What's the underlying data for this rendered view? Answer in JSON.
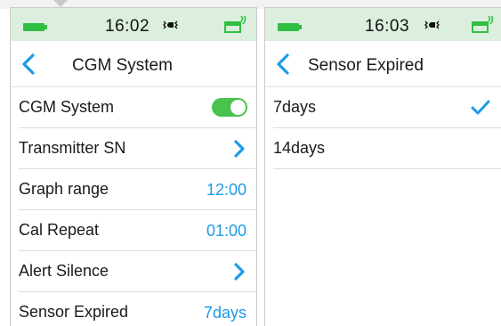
{
  "left_screen": {
    "status": {
      "time": "16:02",
      "vibrate_glyph": "⇶◀⇶",
      "battery_icon": "battery-full-icon",
      "transmitter_icon": "transmitter-signal-icon"
    },
    "title": "CGM System",
    "rows": [
      {
        "label": "CGM System",
        "control": "toggle",
        "on": true
      },
      {
        "label": "Transmitter SN",
        "control": "chevron"
      },
      {
        "label": "Graph range",
        "value": "12:00"
      },
      {
        "label": "Cal Repeat",
        "value": "01:00"
      },
      {
        "label": "Alert Silence",
        "control": "chevron"
      },
      {
        "label": "Sensor Expired",
        "value": "7days"
      }
    ]
  },
  "right_screen": {
    "status": {
      "time": "16:03",
      "vibrate_glyph": "⇶◀⇶",
      "battery_icon": "battery-full-icon",
      "transmitter_icon": "transmitter-signal-icon"
    },
    "title": "Sensor Expired",
    "options": [
      {
        "label": "7days",
        "selected": true
      },
      {
        "label": "14days",
        "selected": false
      }
    ]
  },
  "colors": {
    "statusbar": "#dceede",
    "accent_blue": "#1c9be8",
    "toggle_green": "#48c34e",
    "battery_green": "#2fc043"
  }
}
